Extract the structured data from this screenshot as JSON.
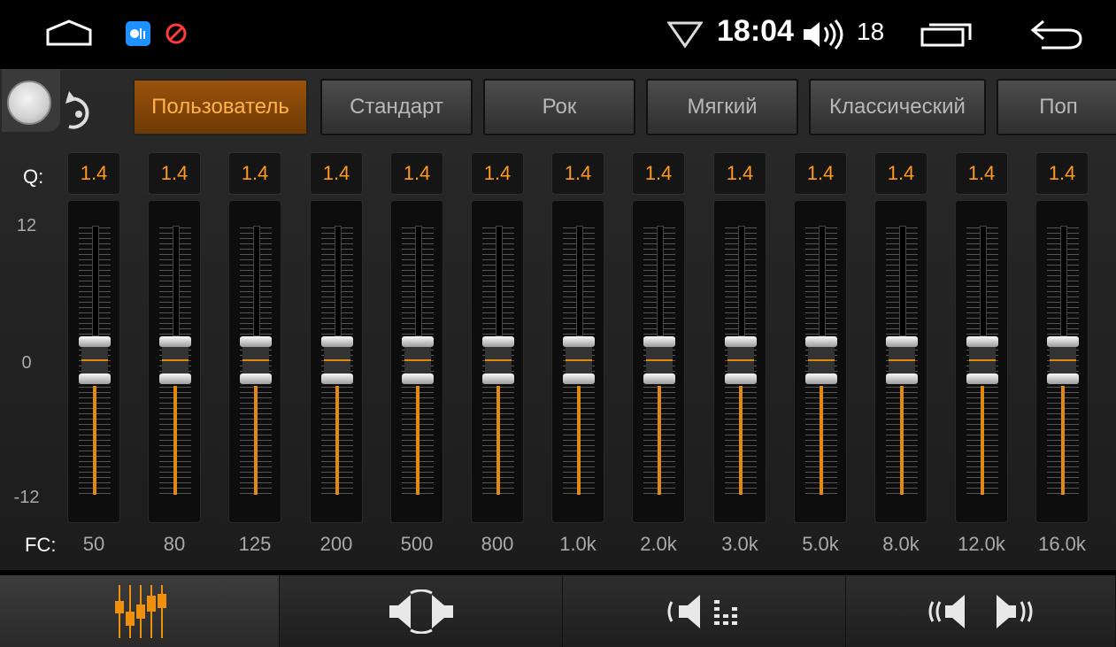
{
  "status_bar": {
    "time": "18:04",
    "volume": "18",
    "app_icon_text": "",
    "icons": [
      "home-icon",
      "app-notification-icon",
      "blocked-icon",
      "wifi-icon",
      "volume-icon",
      "recent-apps-icon",
      "back-icon"
    ]
  },
  "equalizer": {
    "enabled": true,
    "presets": [
      {
        "label": "Пользователь",
        "active": true
      },
      {
        "label": "Стандарт",
        "active": false
      },
      {
        "label": "Рок",
        "active": false
      },
      {
        "label": "Мягкий",
        "active": false
      },
      {
        "label": "Классический",
        "active": false
      },
      {
        "label": "Поп",
        "active": false
      }
    ],
    "q_label": "Q:",
    "fc_label": "FC:",
    "scale": {
      "top": "12",
      "mid": "0",
      "bottom": "-12"
    },
    "bands": [
      {
        "fc": "50",
        "q": "1.4",
        "gain": 0
      },
      {
        "fc": "80",
        "q": "1.4",
        "gain": 0
      },
      {
        "fc": "125",
        "q": "1.4",
        "gain": 0
      },
      {
        "fc": "200",
        "q": "1.4",
        "gain": 0
      },
      {
        "fc": "500",
        "q": "1.4",
        "gain": 0
      },
      {
        "fc": "800",
        "q": "1.4",
        "gain": 0
      },
      {
        "fc": "1.0k",
        "q": "1.4",
        "gain": 0
      },
      {
        "fc": "2.0k",
        "q": "1.4",
        "gain": 0
      },
      {
        "fc": "3.0k",
        "q": "1.4",
        "gain": 0
      },
      {
        "fc": "5.0k",
        "q": "1.4",
        "gain": 0
      },
      {
        "fc": "8.0k",
        "q": "1.4",
        "gain": 0
      },
      {
        "fc": "12.0k",
        "q": "1.4",
        "gain": 0
      },
      {
        "fc": "16.0k",
        "q": "1.4",
        "gain": 0
      }
    ]
  },
  "bottom_tabs": [
    {
      "name": "equalizer-tab",
      "icon": "equalizer-icon",
      "active": true
    },
    {
      "name": "balance-tab",
      "icon": "balance-icon",
      "active": false
    },
    {
      "name": "subwoofer-tab",
      "icon": "subwoofer-icon",
      "active": false
    },
    {
      "name": "surround-tab",
      "icon": "surround-icon",
      "active": false
    }
  ],
  "colors": {
    "accent": "#e08a12",
    "q_text": "#ff9a1e",
    "active_preset": "#9a520b"
  }
}
